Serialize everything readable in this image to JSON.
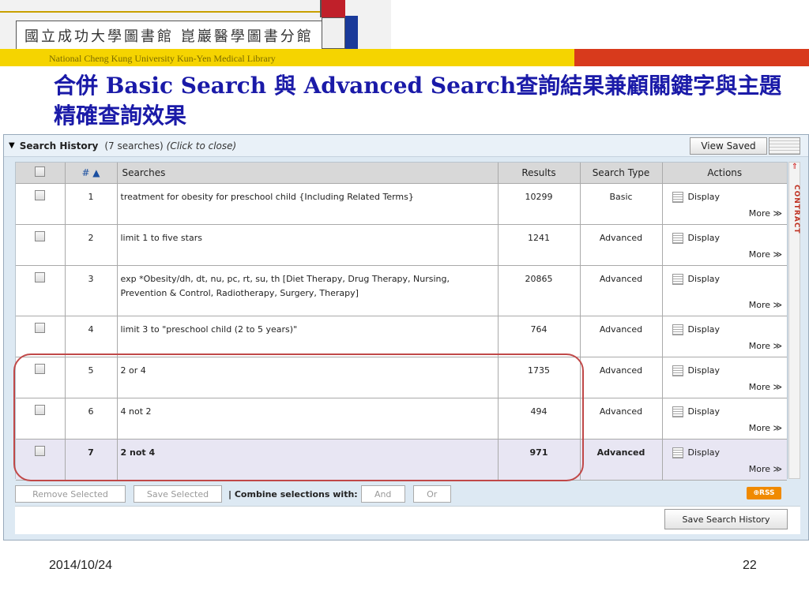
{
  "banner": {
    "logo_text": "國立成功大學圖書館 崑巖醫學圖書分館",
    "subtitle": "National Cheng Kung University Kun-Yen Medical Library"
  },
  "title": "合併 Basic Search 與 Advanced Search查詢結果兼顧關鍵字與主題精確查詢效果",
  "panel": {
    "heading": "Search History",
    "count": "(7 searches)",
    "close_hint": "(Click to close)",
    "view_saved_label": "View Saved"
  },
  "table": {
    "headers": {
      "num": "# ▲",
      "searches": "Searches",
      "results": "Results",
      "search_type": "Search Type",
      "actions": "Actions"
    },
    "display_label": "Display",
    "more_label": "More ≫",
    "rows": [
      {
        "num": "1",
        "search": "treatment for obesity for preschool child {Including Related Terms}",
        "results": "10299",
        "type": "Basic"
      },
      {
        "num": "2",
        "search": "limit 1 to five stars",
        "results": "1241",
        "type": "Advanced"
      },
      {
        "num": "3",
        "search": "exp *Obesity/dh, dt, nu, pc, rt, su, th [Diet Therapy, Drug Therapy, Nursing, Prevention & Control, Radiotherapy, Surgery, Therapy]",
        "results": "20865",
        "type": "Advanced"
      },
      {
        "num": "4",
        "search": "limit 3 to \"preschool child (2 to 5 years)\"",
        "results": "764",
        "type": "Advanced"
      },
      {
        "num": "5",
        "search": "2 or 4",
        "results": "1735",
        "type": "Advanced"
      },
      {
        "num": "6",
        "search": "4 not 2",
        "results": "494",
        "type": "Advanced"
      },
      {
        "num": "7",
        "search": "2 not 4",
        "results": "971",
        "type": "Advanced"
      }
    ]
  },
  "side_tab": {
    "label": "CONTRACT"
  },
  "footer": {
    "remove_selected": "Remove Selected",
    "save_selected": "Save Selected",
    "combine_label": "| Combine selections with:",
    "and_label": "And",
    "or_label": "Or",
    "rss_label": "RSS",
    "save_history": "Save Search History"
  },
  "slide": {
    "date": "2014/10/24",
    "page": "22"
  },
  "colors": {
    "title": "#1a1aa8",
    "highlight": "#c04848",
    "yellow_bar": "#f5d400",
    "red_bar": "#d83a1c"
  }
}
